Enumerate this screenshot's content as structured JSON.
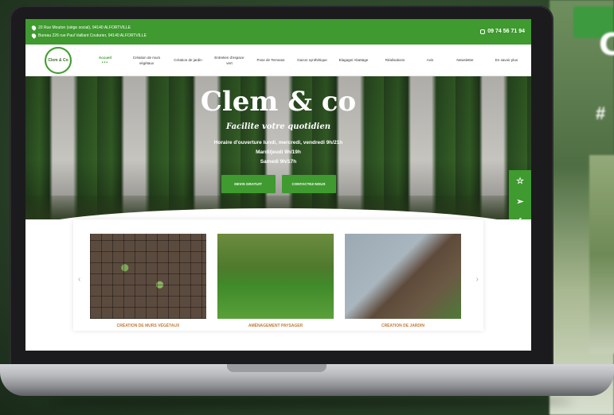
{
  "topbar": {
    "address1": "20 Rue Mouton (siège social), 94140 ALFORTVILLE",
    "address2": "Bureau 226 rue Paul Vaillant Couturier, 94140 ALFORTVILLE",
    "phone": "09 74 56 71 94"
  },
  "nav": {
    "logo": "Clem & Co",
    "items": [
      {
        "label": "Accueil",
        "active": true
      },
      {
        "label": "Création de murs végétaux"
      },
      {
        "label": "Création de jardin"
      },
      {
        "label": "Entretien d'espace vert"
      },
      {
        "label": "Pose de Terrasse"
      },
      {
        "label": "Gazon synthétique"
      },
      {
        "label": "Elagage/ Abattage"
      },
      {
        "label": "Réalisations"
      },
      {
        "label": "Avis"
      },
      {
        "label": "Newsletter"
      },
      {
        "label": "En savoir plus"
      }
    ]
  },
  "hero": {
    "title": "Clem & co",
    "subtitle": "Facilite votre quotidien",
    "hours1": "Horaire d'ouverture lundi, mercredi, vendredi 9h/21h",
    "hours2": "Mardi/jeudi 9h/19h",
    "hours3": "Samedi 9h/17h",
    "btn1": "DEVIS GRATUIT",
    "btn2": "CONTACTEZ-NOUS"
  },
  "social": [
    "star-icon",
    "send-icon",
    "facebook-icon",
    "calendar-icon"
  ],
  "cards": [
    {
      "label": "CRÉATION DE MURS VÉGÉTAUX"
    },
    {
      "label": "AMÉNAGEMENT PAYSAGER"
    },
    {
      "label": "CRÉATION DE JARDIN"
    }
  ],
  "background": {
    "letter": "C",
    "hash": "#"
  },
  "colors": {
    "brand_green": "#3f9a2f",
    "card_label": "#c47a3a"
  }
}
